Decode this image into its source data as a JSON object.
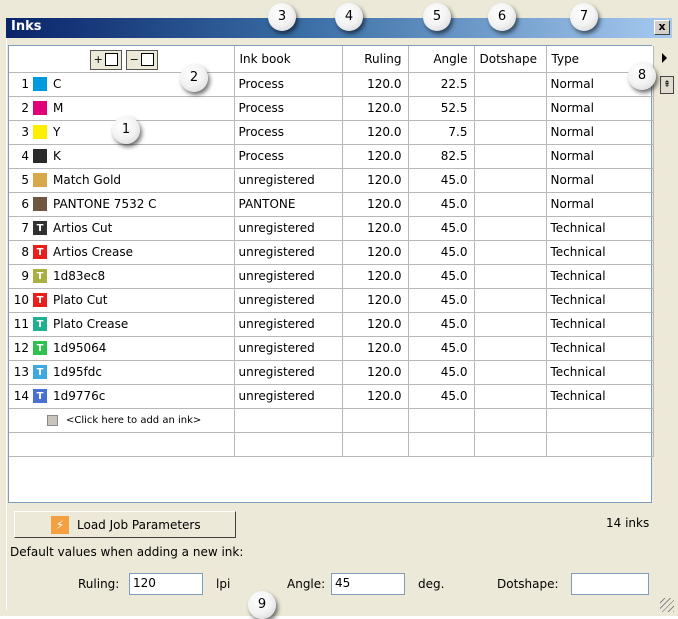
{
  "window": {
    "title": "Inks",
    "close_label": "x"
  },
  "header": {
    "add_button": "+",
    "remove_button": "−",
    "columns": [
      "Ink book",
      "Ruling",
      "Angle",
      "Dotshape",
      "Type"
    ]
  },
  "inks": [
    {
      "num": "1",
      "name": "C",
      "color": "#0099e0",
      "letter": "",
      "book": "Process",
      "ruling": "120.0",
      "angle": "22.5",
      "dotshape": "",
      "type": "Normal"
    },
    {
      "num": "2",
      "name": "M",
      "color": "#e0007a",
      "letter": "",
      "book": "Process",
      "ruling": "120.0",
      "angle": "52.5",
      "dotshape": "",
      "type": "Normal"
    },
    {
      "num": "3",
      "name": "Y",
      "color": "#ffee00",
      "letter": "",
      "book": "Process",
      "ruling": "120.0",
      "angle": "7.5",
      "dotshape": "",
      "type": "Normal"
    },
    {
      "num": "4",
      "name": "K",
      "color": "#2b2b2b",
      "letter": "",
      "book": "Process",
      "ruling": "120.0",
      "angle": "82.5",
      "dotshape": "",
      "type": "Normal"
    },
    {
      "num": "5",
      "name": "Match Gold",
      "color": "#d8a848",
      "letter": "",
      "book": "unregistered",
      "ruling": "120.0",
      "angle": "45.0",
      "dotshape": "",
      "type": "Normal"
    },
    {
      "num": "6",
      "name": "PANTONE 7532 C",
      "color": "#6e5640",
      "letter": "",
      "book": "PANTONE",
      "ruling": "120.0",
      "angle": "45.0",
      "dotshape": "",
      "type": "Normal"
    },
    {
      "num": "7",
      "name": "Artios Cut",
      "color": "#303030",
      "letter": "T",
      "book": "unregistered",
      "ruling": "120.0",
      "angle": "45.0",
      "dotshape": "",
      "type": "Technical"
    },
    {
      "num": "8",
      "name": "Artios Crease",
      "color": "#e8201c",
      "letter": "T",
      "book": "unregistered",
      "ruling": "120.0",
      "angle": "45.0",
      "dotshape": "",
      "type": "Technical"
    },
    {
      "num": "9",
      "name": "1d83ec8",
      "color": "#a8b040",
      "letter": "T",
      "book": "unregistered",
      "ruling": "120.0",
      "angle": "45.0",
      "dotshape": "",
      "type": "Technical"
    },
    {
      "num": "10",
      "name": "Plato Cut",
      "color": "#e8201c",
      "letter": "T",
      "book": "unregistered",
      "ruling": "120.0",
      "angle": "45.0",
      "dotshape": "",
      "type": "Technical"
    },
    {
      "num": "11",
      "name": "Plato Crease",
      "color": "#20b090",
      "letter": "T",
      "book": "unregistered",
      "ruling": "120.0",
      "angle": "45.0",
      "dotshape": "",
      "type": "Technical"
    },
    {
      "num": "12",
      "name": "1d95064",
      "color": "#30c050",
      "letter": "T",
      "book": "unregistered",
      "ruling": "120.0",
      "angle": "45.0",
      "dotshape": "",
      "type": "Technical"
    },
    {
      "num": "13",
      "name": "1d95fdc",
      "color": "#40a8e0",
      "letter": "T",
      "book": "unregistered",
      "ruling": "120.0",
      "angle": "45.0",
      "dotshape": "",
      "type": "Technical"
    },
    {
      "num": "14",
      "name": "1d9776c",
      "color": "#4870d0",
      "letter": "T",
      "book": "unregistered",
      "ruling": "120.0",
      "angle": "45.0",
      "dotshape": "",
      "type": "Technical"
    }
  ],
  "add_ink_label": "<Click here to add an ink>",
  "load_button": {
    "label": "Load Job Parameters",
    "icon": "lightning-icon"
  },
  "ink_count": "14 inks",
  "defaults": {
    "heading": "Default values when adding a new ink:",
    "ruling_label": "Ruling:",
    "ruling_value": "120",
    "ruling_unit": "lpi",
    "angle_label": "Angle:",
    "angle_value": "45",
    "angle_unit": "deg.",
    "dotshape_label": "Dotshape:",
    "dotshape_value": ""
  },
  "callouts": [
    "1",
    "2",
    "3",
    "4",
    "5",
    "6",
    "7",
    "8",
    "9"
  ]
}
